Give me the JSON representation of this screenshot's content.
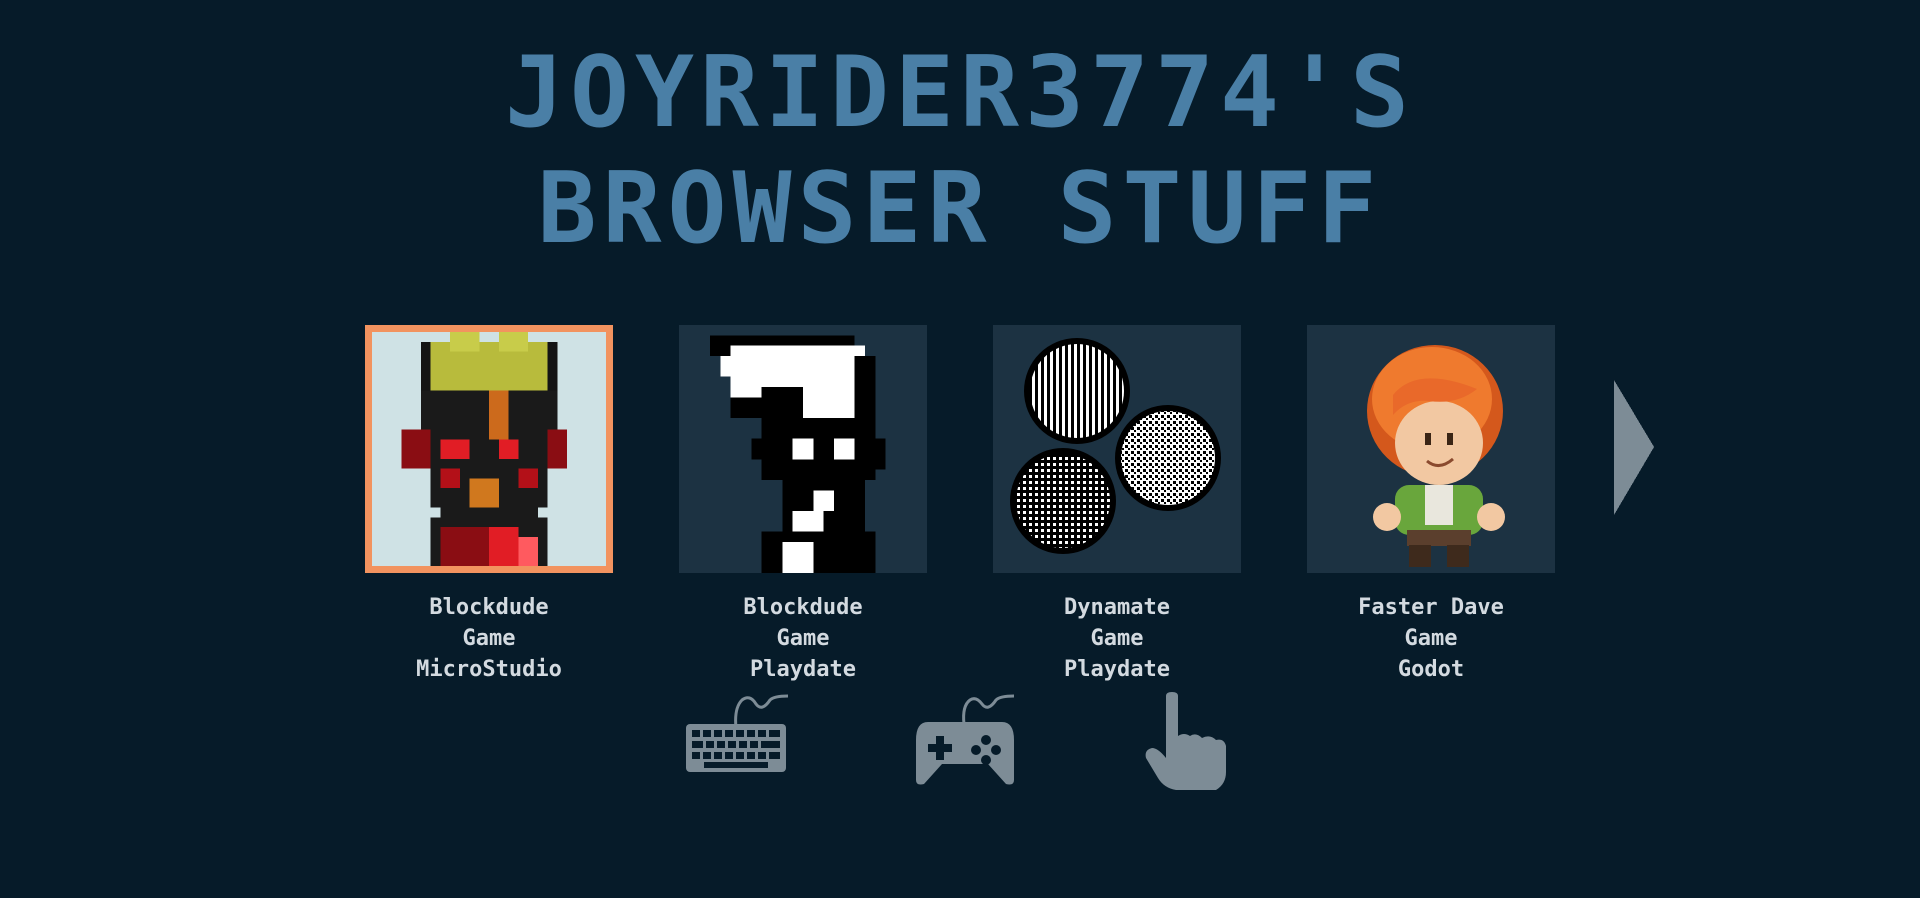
{
  "title": {
    "line1": "JOYRIDER3774'S",
    "line2": "BROWSER STUFF"
  },
  "games": [
    {
      "name": "Blockdude",
      "type": "Game",
      "platform": "MicroStudio",
      "selected": true
    },
    {
      "name": "Blockdude",
      "type": "Game",
      "platform": "Playdate",
      "selected": false
    },
    {
      "name": "Dynamate",
      "type": "Game",
      "platform": "Playdate",
      "selected": false
    },
    {
      "name": "Faster Dave",
      "type": "Game",
      "platform": "Godot",
      "selected": false
    }
  ],
  "controls": [
    "keyboard-icon",
    "gamepad-icon",
    "pointer-hand-icon"
  ],
  "colors": {
    "background": "#061b29",
    "title": "#4a7fa6",
    "selection": "#f2935f",
    "card": "#1c3242",
    "text": "#d3dae0",
    "icon": "#7d8c96"
  }
}
